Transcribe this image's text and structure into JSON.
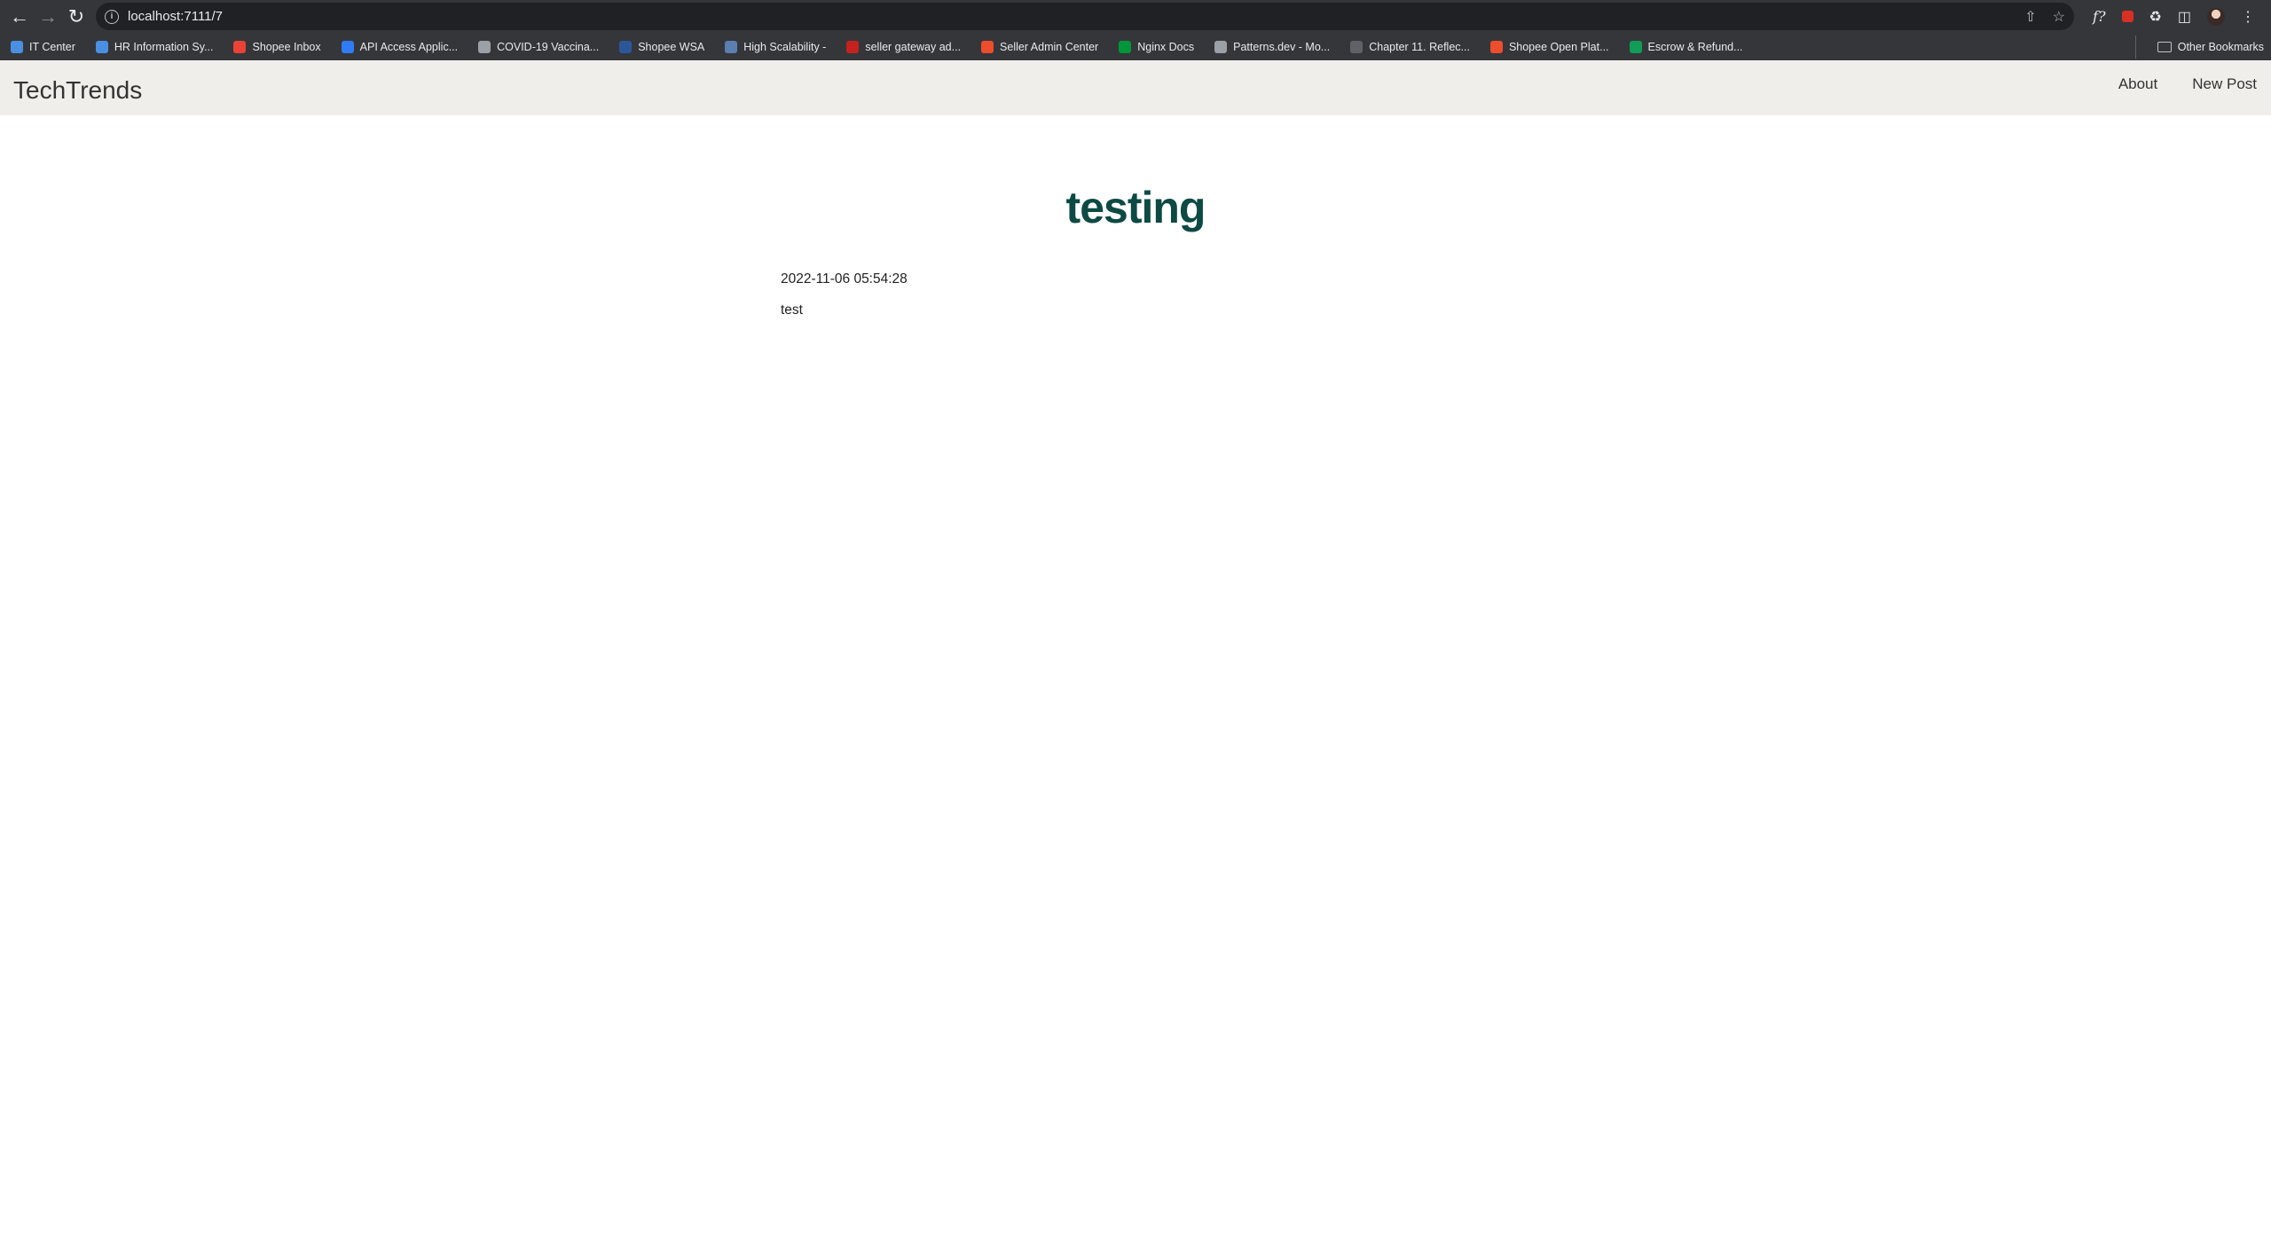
{
  "browser": {
    "url": "localhost:7111/7",
    "bookmarks": [
      {
        "label": "IT Center",
        "icon": "it-center-icon",
        "color": "#4a90e2"
      },
      {
        "label": "HR Information Sy...",
        "icon": "hr-icon",
        "color": "#4a90e2"
      },
      {
        "label": "Shopee Inbox",
        "icon": "gmail-icon",
        "color": "#ea4335"
      },
      {
        "label": "API Access Applic...",
        "icon": "api-icon",
        "color": "#2f7cf6"
      },
      {
        "label": "COVID-19 Vaccina...",
        "icon": "covid-icon",
        "color": "#9aa0a6"
      },
      {
        "label": "Shopee WSA",
        "icon": "word-icon",
        "color": "#2b579a"
      },
      {
        "label": "High Scalability -",
        "icon": "hs-icon",
        "color": "#5b7fb0"
      },
      {
        "label": "seller gateway ad...",
        "icon": "seller-gateway-icon",
        "color": "#c5221f"
      },
      {
        "label": "Seller Admin Center",
        "icon": "shopee-icon",
        "color": "#ee4d2d"
      },
      {
        "label": "Nginx Docs",
        "icon": "nginx-icon",
        "color": "#009639"
      },
      {
        "label": "Patterns.dev - Mo...",
        "icon": "patterns-icon",
        "color": "#9aa0a6"
      },
      {
        "label": "Chapter 11. Reflec...",
        "icon": "chapter-icon",
        "color": "#5f6368"
      },
      {
        "label": "Shopee Open Plat...",
        "icon": "shopee-icon",
        "color": "#ee4d2d"
      },
      {
        "label": "Escrow & Refund...",
        "icon": "escrow-icon",
        "color": "#0f9d58"
      }
    ],
    "other_bookmarks": "Other Bookmarks"
  },
  "site": {
    "brand": "TechTrends",
    "nav": {
      "about": "About",
      "new_post": "New Post"
    }
  },
  "post": {
    "title": "testing",
    "date": "2022-11-06 05:54:28",
    "content": "test"
  }
}
